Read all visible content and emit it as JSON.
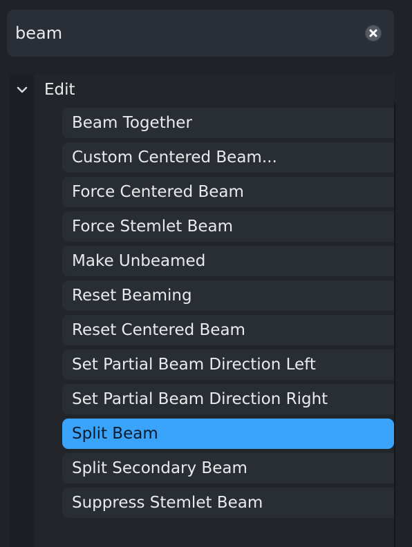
{
  "search": {
    "value": "beam"
  },
  "tree": {
    "group_label": "Edit",
    "items": [
      {
        "label": "Beam Together",
        "selected": false
      },
      {
        "label": "Custom Centered Beam...",
        "selected": false
      },
      {
        "label": "Force Centered Beam",
        "selected": false
      },
      {
        "label": "Force Stemlet Beam",
        "selected": false
      },
      {
        "label": "Make Unbeamed",
        "selected": false
      },
      {
        "label": "Reset Beaming",
        "selected": false
      },
      {
        "label": "Reset Centered Beam",
        "selected": false
      },
      {
        "label": "Set Partial Beam Direction Left",
        "selected": false
      },
      {
        "label": "Set Partial Beam Direction Right",
        "selected": false
      },
      {
        "label": "Split Beam",
        "selected": true
      },
      {
        "label": "Split Secondary Beam",
        "selected": false
      },
      {
        "label": "Suppress Stemlet Beam",
        "selected": false
      }
    ]
  },
  "colors": {
    "background": "#1f2227",
    "search_field": "#2a2f37",
    "item": "#292d34",
    "selection": "#3aa4fb",
    "text": "#e9eaec"
  },
  "icons": {
    "clear": "clear-icon",
    "expand": "chevron-down-icon"
  }
}
